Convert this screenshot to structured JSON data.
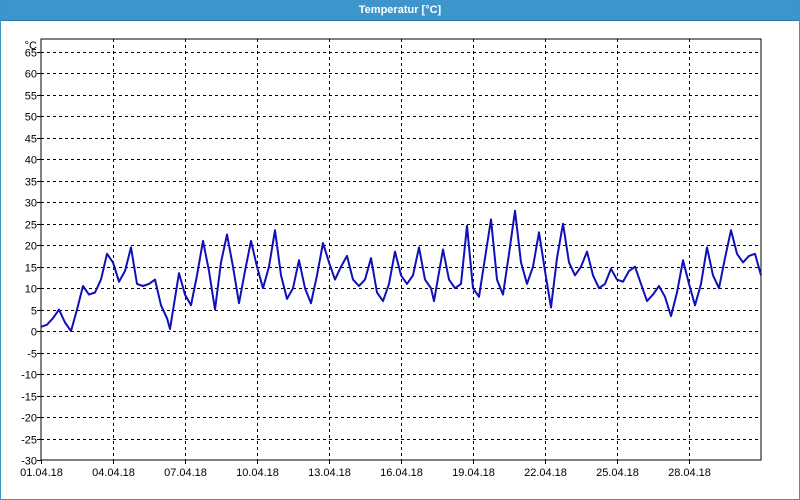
{
  "window": {
    "title": "Temperatur [°C]"
  },
  "colors": {
    "line": "#1010b8",
    "titlebar": "#3d95cc",
    "grid": "#000000"
  },
  "chart_data": {
    "type": "line",
    "title": "Temperatur [°C]",
    "ylabel": "°C",
    "xlabel": "",
    "ylim": [
      -30,
      68
    ],
    "y_ticks": [
      65,
      60,
      55,
      50,
      45,
      40,
      35,
      30,
      25,
      20,
      15,
      10,
      5,
      0,
      -5,
      -10,
      -15,
      -20,
      -25,
      -30
    ],
    "x_range": [
      "2018-04-01",
      "2018-05-01"
    ],
    "x_ticks": [
      "01.04.18",
      "04.04.18",
      "07.04.18",
      "10.04.18",
      "13.04.18",
      "16.04.18",
      "19.04.18",
      "22.04.18",
      "25.04.18",
      "28.04.18"
    ],
    "grid": true,
    "series": [
      {
        "values": [
          [
            "2018-04-01",
            1
          ],
          [
            "2018-04-01 06:00",
            1.5
          ],
          [
            "2018-04-01 12:00",
            3
          ],
          [
            "2018-04-01 18:00",
            5
          ],
          [
            "2018-04-02 00:00",
            2
          ],
          [
            "2018-04-02 06:00",
            0
          ],
          [
            "2018-04-02 12:00",
            5
          ],
          [
            "2018-04-02 18:00",
            10.5
          ],
          [
            "2018-04-03 00:00",
            8.5
          ],
          [
            "2018-04-03 06:00",
            9
          ],
          [
            "2018-04-03 12:00",
            12
          ],
          [
            "2018-04-03 18:00",
            18
          ],
          [
            "2018-04-04 00:00",
            16
          ],
          [
            "2018-04-04 06:00",
            11.5
          ],
          [
            "2018-04-04 12:00",
            14
          ],
          [
            "2018-04-04 18:00",
            19.5
          ],
          [
            "2018-04-05 00:00",
            11
          ],
          [
            "2018-04-05 06:00",
            10.5
          ],
          [
            "2018-04-05 12:00",
            11
          ],
          [
            "2018-04-05 18:00",
            12
          ],
          [
            "2018-04-06 00:00",
            6
          ],
          [
            "2018-04-06 06:00",
            3
          ],
          [
            "2018-04-06 09:00",
            0.5
          ],
          [
            "2018-04-06 18:00",
            13.5
          ],
          [
            "2018-04-07 00:00",
            8.5
          ],
          [
            "2018-04-07 06:00",
            6
          ],
          [
            "2018-04-07 12:00",
            13
          ],
          [
            "2018-04-07 18:00",
            21
          ],
          [
            "2018-04-08 00:00",
            14
          ],
          [
            "2018-04-08 06:00",
            5
          ],
          [
            "2018-04-08 12:00",
            16
          ],
          [
            "2018-04-08 18:00",
            22.5
          ],
          [
            "2018-04-09 00:00",
            15
          ],
          [
            "2018-04-09 06:00",
            6.5
          ],
          [
            "2018-04-09 12:00",
            14
          ],
          [
            "2018-04-09 18:00",
            21
          ],
          [
            "2018-04-10 00:00",
            15
          ],
          [
            "2018-04-10 06:00",
            10
          ],
          [
            "2018-04-10 12:00",
            15
          ],
          [
            "2018-04-10 18:00",
            23.5
          ],
          [
            "2018-04-11 00:00",
            13
          ],
          [
            "2018-04-11 06:00",
            7.5
          ],
          [
            "2018-04-11 12:00",
            10
          ],
          [
            "2018-04-11 18:00",
            16.5
          ],
          [
            "2018-04-12 00:00",
            10
          ],
          [
            "2018-04-12 06:00",
            6.5
          ],
          [
            "2018-04-12 12:00",
            13
          ],
          [
            "2018-04-12 18:00",
            20.5
          ],
          [
            "2018-04-13 00:00",
            16
          ],
          [
            "2018-04-13 06:00",
            12
          ],
          [
            "2018-04-13 12:00",
            15
          ],
          [
            "2018-04-13 18:00",
            17.5
          ],
          [
            "2018-04-14 00:00",
            12
          ],
          [
            "2018-04-14 06:00",
            10.5
          ],
          [
            "2018-04-14 12:00",
            12
          ],
          [
            "2018-04-14 18:00",
            17
          ],
          [
            "2018-04-15 00:00",
            9
          ],
          [
            "2018-04-15 06:00",
            7
          ],
          [
            "2018-04-15 12:00",
            11
          ],
          [
            "2018-04-15 18:00",
            18.5
          ],
          [
            "2018-04-16 00:00",
            13
          ],
          [
            "2018-04-16 06:00",
            11
          ],
          [
            "2018-04-16 12:00",
            13
          ],
          [
            "2018-04-16 18:00",
            19.5
          ],
          [
            "2018-04-17 00:00",
            12
          ],
          [
            "2018-04-17 06:00",
            10
          ],
          [
            "2018-04-17 09:00",
            7
          ],
          [
            "2018-04-17 18:00",
            19
          ],
          [
            "2018-04-18 00:00",
            12
          ],
          [
            "2018-04-18 06:00",
            10
          ],
          [
            "2018-04-18 12:00",
            11
          ],
          [
            "2018-04-18 18:00",
            24.5
          ],
          [
            "2018-04-19 00:00",
            10
          ],
          [
            "2018-04-19 06:00",
            8
          ],
          [
            "2018-04-19 12:00",
            17
          ],
          [
            "2018-04-19 18:00",
            26
          ],
          [
            "2018-04-20 00:00",
            12
          ],
          [
            "2018-04-20 06:00",
            8.5
          ],
          [
            "2018-04-20 12:00",
            18
          ],
          [
            "2018-04-20 18:00",
            28
          ],
          [
            "2018-04-21 00:00",
            16
          ],
          [
            "2018-04-21 06:00",
            11
          ],
          [
            "2018-04-21 12:00",
            15
          ],
          [
            "2018-04-21 18:00",
            23
          ],
          [
            "2018-04-22 00:00",
            14
          ],
          [
            "2018-04-22 06:00",
            5.5
          ],
          [
            "2018-04-22 12:00",
            17
          ],
          [
            "2018-04-22 18:00",
            25
          ],
          [
            "2018-04-23 00:00",
            16
          ],
          [
            "2018-04-23 06:00",
            13
          ],
          [
            "2018-04-23 12:00",
            15
          ],
          [
            "2018-04-23 18:00",
            18.5
          ],
          [
            "2018-04-24 00:00",
            13
          ],
          [
            "2018-04-24 06:00",
            10
          ],
          [
            "2018-04-24 12:00",
            11
          ],
          [
            "2018-04-24 18:00",
            14.5
          ],
          [
            "2018-04-25 00:00",
            12
          ],
          [
            "2018-04-25 06:00",
            11.5
          ],
          [
            "2018-04-25 12:00",
            14
          ],
          [
            "2018-04-25 18:00",
            15
          ],
          [
            "2018-04-26 00:00",
            11
          ],
          [
            "2018-04-26 06:00",
            7
          ],
          [
            "2018-04-26 12:00",
            8.5
          ],
          [
            "2018-04-26 18:00",
            10.5
          ],
          [
            "2018-04-27 00:00",
            8
          ],
          [
            "2018-04-27 06:00",
            3.5
          ],
          [
            "2018-04-27 12:00",
            9
          ],
          [
            "2018-04-27 18:00",
            16.5
          ],
          [
            "2018-04-28 00:00",
            11
          ],
          [
            "2018-04-28 06:00",
            6
          ],
          [
            "2018-04-28 12:00",
            11
          ],
          [
            "2018-04-28 18:00",
            19.5
          ],
          [
            "2018-04-29 00:00",
            13
          ],
          [
            "2018-04-29 06:00",
            10
          ],
          [
            "2018-04-29 12:00",
            17
          ],
          [
            "2018-04-29 18:00",
            23.5
          ],
          [
            "2018-04-30 00:00",
            18
          ],
          [
            "2018-04-30 06:00",
            16
          ],
          [
            "2018-04-30 12:00",
            17.5
          ],
          [
            "2018-04-30 18:00",
            18
          ],
          [
            "2018-05-01",
            13
          ]
        ]
      }
    ]
  }
}
